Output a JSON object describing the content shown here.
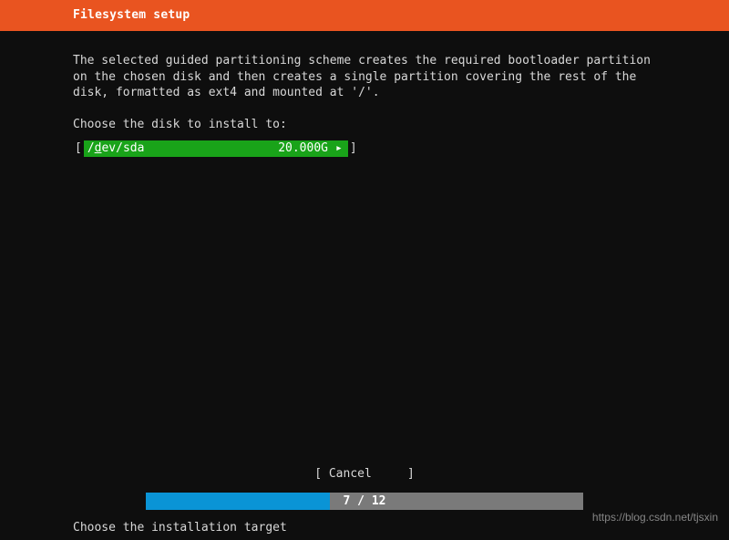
{
  "header": {
    "title": "Filesystem setup"
  },
  "main": {
    "description": "The selected guided partitioning scheme creates the required bootloader partition on the chosen disk and then creates a single partition covering the rest of the disk, formatted as ext4 and mounted at '/'.",
    "prompt": "Choose the disk to install to:",
    "disk": {
      "open_bracket": "[",
      "device_prefix": " /",
      "device_accel": "d",
      "device_rest": "ev/sda",
      "size": "20.000G",
      "arrow": "▸",
      "close_bracket": "]"
    }
  },
  "actions": {
    "cancel_display": "[ Cancel     ]"
  },
  "progress": {
    "current": 7,
    "total": 12,
    "label": "7 / 12",
    "fill_pct": "42%",
    "used_pct": "100%"
  },
  "footer": {
    "hint": "Choose the installation target"
  },
  "watermark": "https://blog.csdn.net/tjsxin"
}
